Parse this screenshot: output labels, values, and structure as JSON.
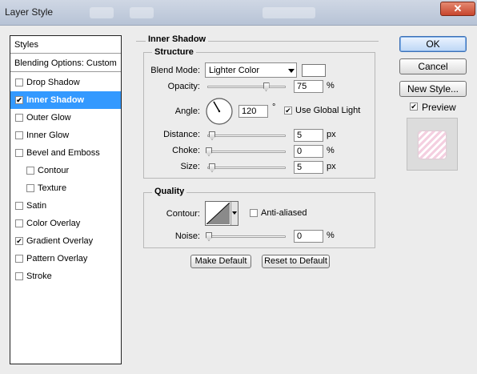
{
  "window": {
    "title": "Layer Style",
    "close_glyph": "✕"
  },
  "styles_panel": {
    "header": "Styles",
    "blending_options": "Blending Options: Custom",
    "items": [
      {
        "label": "Drop Shadow",
        "checked": false,
        "selected": false,
        "indent": false
      },
      {
        "label": "Inner Shadow",
        "checked": true,
        "selected": true,
        "indent": false
      },
      {
        "label": "Outer Glow",
        "checked": false,
        "selected": false,
        "indent": false
      },
      {
        "label": "Inner Glow",
        "checked": false,
        "selected": false,
        "indent": false
      },
      {
        "label": "Bevel and Emboss",
        "checked": false,
        "selected": false,
        "indent": false
      },
      {
        "label": "Contour",
        "checked": false,
        "selected": false,
        "indent": true
      },
      {
        "label": "Texture",
        "checked": false,
        "selected": false,
        "indent": true
      },
      {
        "label": "Satin",
        "checked": false,
        "selected": false,
        "indent": false
      },
      {
        "label": "Color Overlay",
        "checked": false,
        "selected": false,
        "indent": false
      },
      {
        "label": "Gradient Overlay",
        "checked": true,
        "selected": false,
        "indent": false
      },
      {
        "label": "Pattern Overlay",
        "checked": false,
        "selected": false,
        "indent": false
      },
      {
        "label": "Stroke",
        "checked": false,
        "selected": false,
        "indent": false
      }
    ]
  },
  "inner_shadow": {
    "title": "Inner Shadow",
    "structure": {
      "title": "Structure",
      "blend_mode_label": "Blend Mode:",
      "blend_mode_value": "Lighter Color",
      "color_swatch": "#ffffff",
      "opacity_label": "Opacity:",
      "opacity_value": "75",
      "opacity_unit": "%",
      "opacity_fraction": 0.75,
      "angle_label": "Angle:",
      "angle_value": "120",
      "angle_degrees": 120,
      "angle_unit": "°",
      "use_global_light_label": "Use Global Light",
      "use_global_light_checked": true,
      "distance_label": "Distance:",
      "distance_value": "5",
      "distance_unit": "px",
      "choke_label": "Choke:",
      "choke_value": "0",
      "choke_unit": "%",
      "size_label": "Size:",
      "size_value": "5",
      "size_unit": "px"
    },
    "quality": {
      "title": "Quality",
      "contour_label": "Contour:",
      "anti_aliased_label": "Anti-aliased",
      "anti_aliased_checked": false,
      "noise_label": "Noise:",
      "noise_value": "0",
      "noise_unit": "%"
    },
    "make_default_label": "Make Default",
    "reset_default_label": "Reset to Default"
  },
  "actions": {
    "ok_label": "OK",
    "cancel_label": "Cancel",
    "new_style_label": "New Style...",
    "preview_label": "Preview",
    "preview_checked": true
  },
  "colors": {
    "selection": "#3399ff",
    "dialog_bg": "#ececec"
  }
}
